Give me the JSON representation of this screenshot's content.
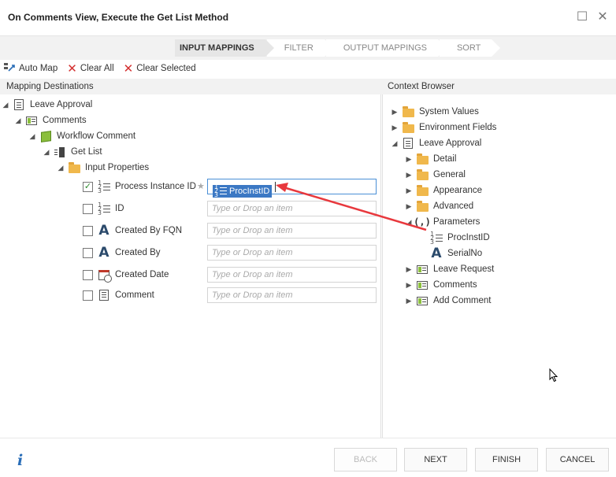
{
  "window": {
    "title": "On Comments View, Execute the Get List Method"
  },
  "wizard": {
    "steps": [
      "INPUT MAPPINGS",
      "FILTER",
      "OUTPUT MAPPINGS",
      "SORT"
    ],
    "active_step": "INPUT MAPPINGS"
  },
  "toolbar": {
    "auto_map": "Auto Map",
    "clear_all": "Clear All",
    "clear_selected": "Clear Selected"
  },
  "left_pane": {
    "header": "Mapping Destinations",
    "tree": {
      "root": "Leave Approval",
      "comments": "Comments",
      "workflow_comment": "Workflow Comment",
      "get_list": "Get List",
      "input_properties": "Input Properties"
    },
    "fields": [
      {
        "label": "Process Instance ID",
        "checked": true,
        "icon": "number-icon",
        "required": true,
        "mapped": "ProcInstID"
      },
      {
        "label": "ID",
        "checked": false,
        "icon": "number-icon",
        "placeholder": "Type or Drop an item"
      },
      {
        "label": "Created By FQN",
        "checked": false,
        "icon": "text-icon",
        "placeholder": "Type or Drop an item"
      },
      {
        "label": "Created By",
        "checked": false,
        "icon": "text-icon",
        "placeholder": "Type or Drop an item"
      },
      {
        "label": "Created Date",
        "checked": false,
        "icon": "datetime-icon",
        "placeholder": "Type or Drop an item"
      },
      {
        "label": "Comment",
        "checked": false,
        "icon": "memo-icon",
        "placeholder": "Type or Drop an item"
      }
    ],
    "star_glyph": "★"
  },
  "right_pane": {
    "header": "Context Browser",
    "items": {
      "system_values": "System Values",
      "environment_fields": "Environment Fields",
      "leave_approval": "Leave Approval",
      "detail": "Detail",
      "general": "General",
      "appearance": "Appearance",
      "advanced": "Advanced",
      "parameters": "Parameters",
      "procinstid": "ProcInstID",
      "serialno": "SerialNo",
      "leave_request": "Leave Request",
      "comments": "Comments",
      "add_comment": "Add Comment"
    },
    "parameters_glyph": "(,)"
  },
  "footer": {
    "back": "BACK",
    "next": "NEXT",
    "finish": "FINISH",
    "cancel": "CANCEL",
    "info_glyph": "i"
  },
  "glyphs": {
    "expanded": "◢",
    "collapsed": "▶",
    "check": "✓",
    "close": "✕",
    "maximize": "☐",
    "text_a": "A"
  },
  "colors": {
    "accent": "#3b78c4",
    "arrow": "#e8383d",
    "folder": "#f0b84c",
    "smartobject": "#8bbf3c",
    "clear": "#d32f2f"
  }
}
